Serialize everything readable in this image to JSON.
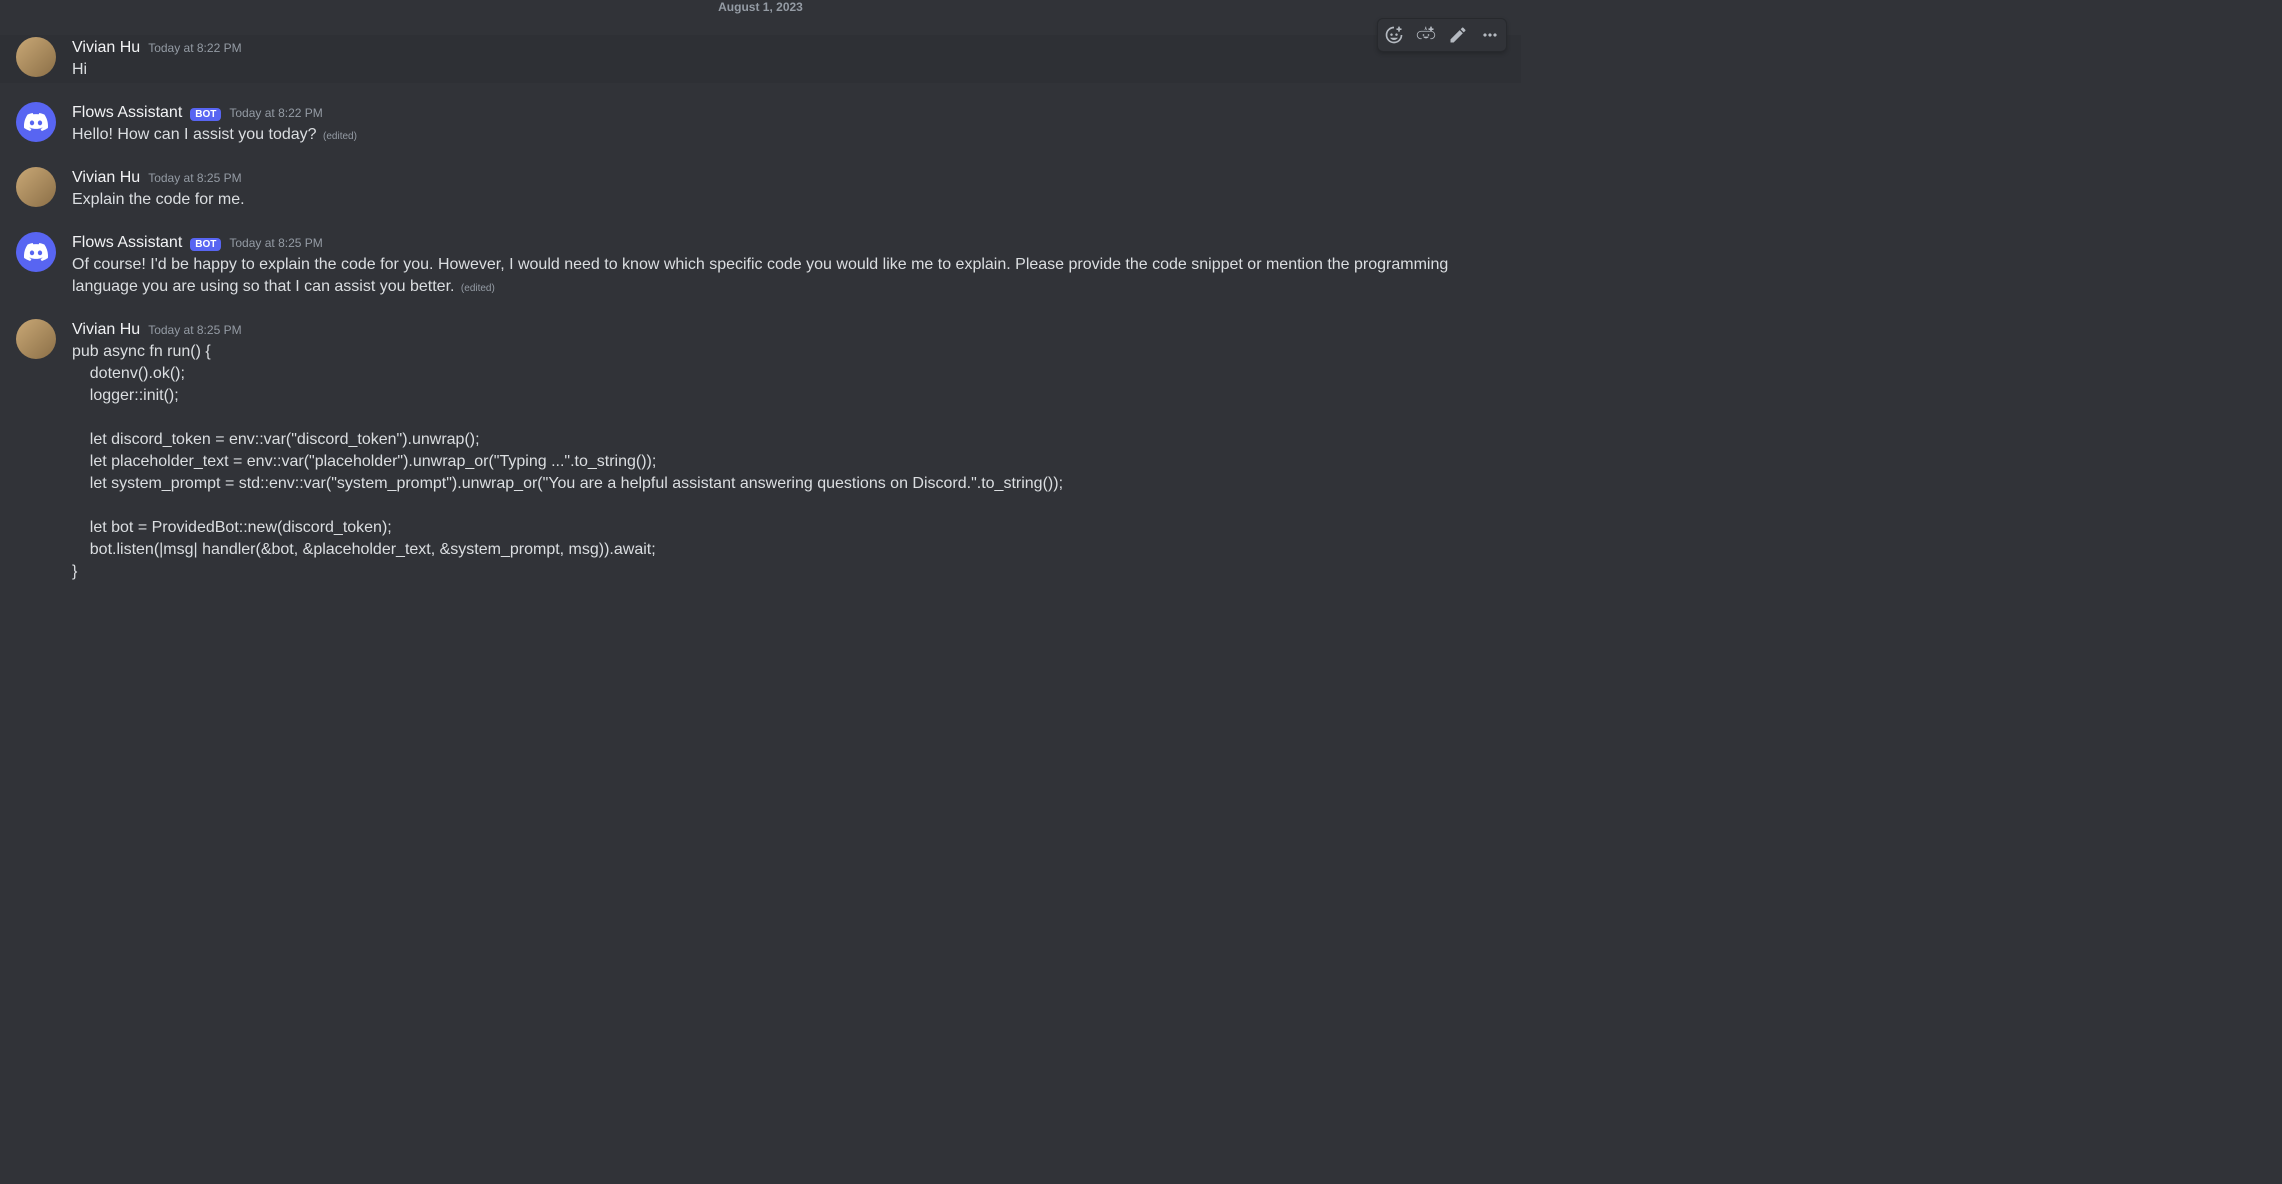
{
  "date_divider": "August 1, 2023",
  "edited_label": "(edited)",
  "users": {
    "vivian": {
      "name": "Vivian Hu",
      "is_bot": false
    },
    "flows": {
      "name": "Flows Assistant",
      "is_bot": true,
      "bot_label": "BOT"
    }
  },
  "toolbar": {
    "react_emoji": "Add Reaction",
    "super_react": "Add Super Reaction",
    "edit": "Edit",
    "more": "More"
  },
  "messages": [
    {
      "author": "vivian",
      "timestamp": "Today at 8:22 PM",
      "content": "Hi",
      "highlighted": true,
      "show_toolbar": true
    },
    {
      "author": "flows",
      "timestamp": "Today at 8:22 PM",
      "content": "Hello! How can I assist you today?",
      "edited": true
    },
    {
      "author": "vivian",
      "timestamp": "Today at 8:25 PM",
      "content": "Explain the code for me."
    },
    {
      "author": "flows",
      "timestamp": "Today at 8:25 PM",
      "content": "Of course! I'd be happy to explain the code for you. However, I would need to know which specific code you would like me to explain. Please provide the code snippet or mention the programming language you are using so that I can assist you better.",
      "edited": true
    },
    {
      "author": "vivian",
      "timestamp": "Today at 8:25 PM",
      "content": "pub async fn run() {\n    dotenv().ok();\n    logger::init();\n\n    let discord_token = env::var(\"discord_token\").unwrap();\n    let placeholder_text = env::var(\"placeholder\").unwrap_or(\"Typing ...\".to_string());\n    let system_prompt = std::env::var(\"system_prompt\").unwrap_or(\"You are a helpful assistant answering questions on Discord.\".to_string());\n\n    let bot = ProvidedBot::new(discord_token);\n    bot.listen(|msg| handler(&bot, &placeholder_text, &system_prompt, msg)).await;\n}"
    }
  ]
}
